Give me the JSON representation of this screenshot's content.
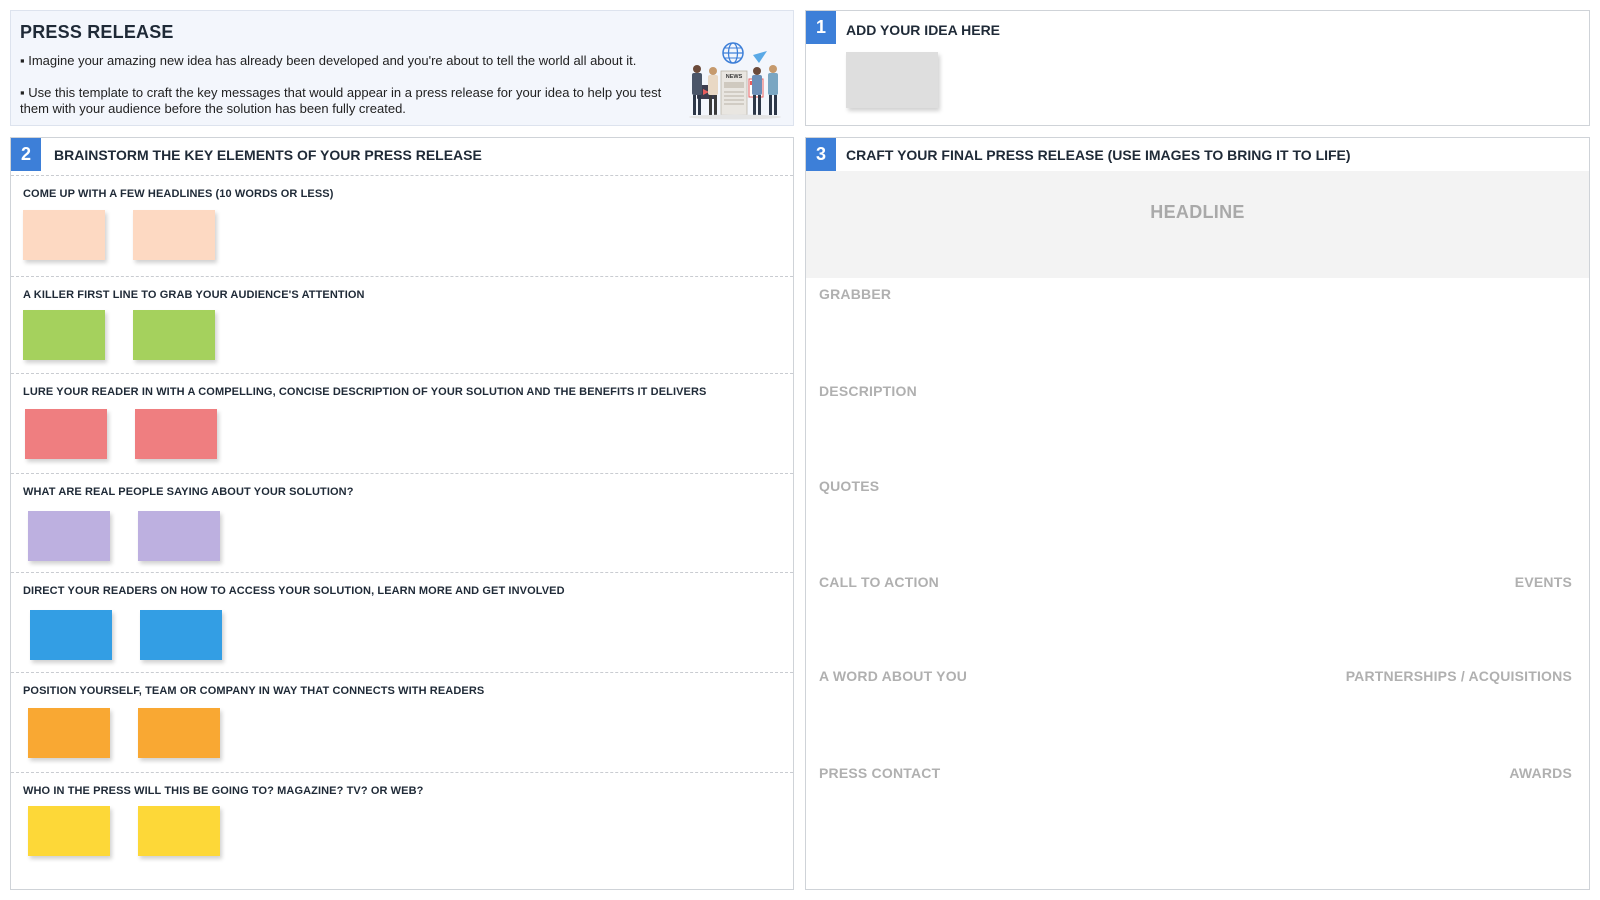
{
  "intro": {
    "title": "PRESS RELEASE",
    "bullet1": "▪ Imagine your amazing new idea has already been developed and you're about to tell the world all about it.",
    "bullet2": "▪ Use this template to craft the key messages that would appear in a press release for your idea to help you test them with your audience before the solution has been fully created.",
    "art_icon": "news-illustration-icon",
    "art_text": "NEWS"
  },
  "idea": {
    "number": "1",
    "title": "ADD YOUR IDEA HERE",
    "note_color": "#dedede"
  },
  "brainstorm": {
    "number": "2",
    "title": "BRAINSTORM THE KEY ELEMENTS OF YOUR PRESS RELEASE",
    "sections": [
      {
        "label": "COME UP WITH A FEW HEADLINES  (10 WORDS OR LESS)",
        "color": "#fdd9c2"
      },
      {
        "label": "A KILLER FIRST LINE TO GRAB YOUR AUDIENCE'S ATTENTION",
        "color": "#a5d15d"
      },
      {
        "label": "LURE YOUR READER IN WITH A COMPELLING, CONCISE DESCRIPTION OF YOUR SOLUTION AND THE BENEFITS IT DELIVERS",
        "color": "#ef7e80"
      },
      {
        "label": "WHAT ARE REAL PEOPLE SAYING ABOUT YOUR SOLUTION?",
        "color": "#bdb0e0"
      },
      {
        "label": "DIRECT YOUR READERS ON HOW TO ACCESS YOUR SOLUTION, LEARN MORE AND GET INVOLVED",
        "color": "#339ee4"
      },
      {
        "label": "POSITION YOURSELF, TEAM OR COMPANY IN WAY THAT CONNECTS WITH READERS",
        "color": "#f9a833"
      },
      {
        "label": "WHO IN THE PRESS WILL THIS BE GOING TO? MAGAZINE? TV? OR WEB?",
        "color": "#fdd838"
      }
    ]
  },
  "craft": {
    "number": "3",
    "title": "CRAFT YOUR FINAL PRESS RELEASE (USE IMAGES TO BRING IT TO LIFE)",
    "headline": "HEADLINE",
    "grabber": "GRABBER",
    "description": "DESCRIPTION",
    "quotes": "QUOTES",
    "call_to_action": "CALL TO ACTION",
    "events": "EVENTS",
    "about_you": "A WORD ABOUT YOU",
    "partnerships": "PARTNERSHIPS / ACQUISITIONS",
    "press_contact": "PRESS CONTACT",
    "awards": "AWARDS"
  },
  "accent_color": "#3d7fd8"
}
